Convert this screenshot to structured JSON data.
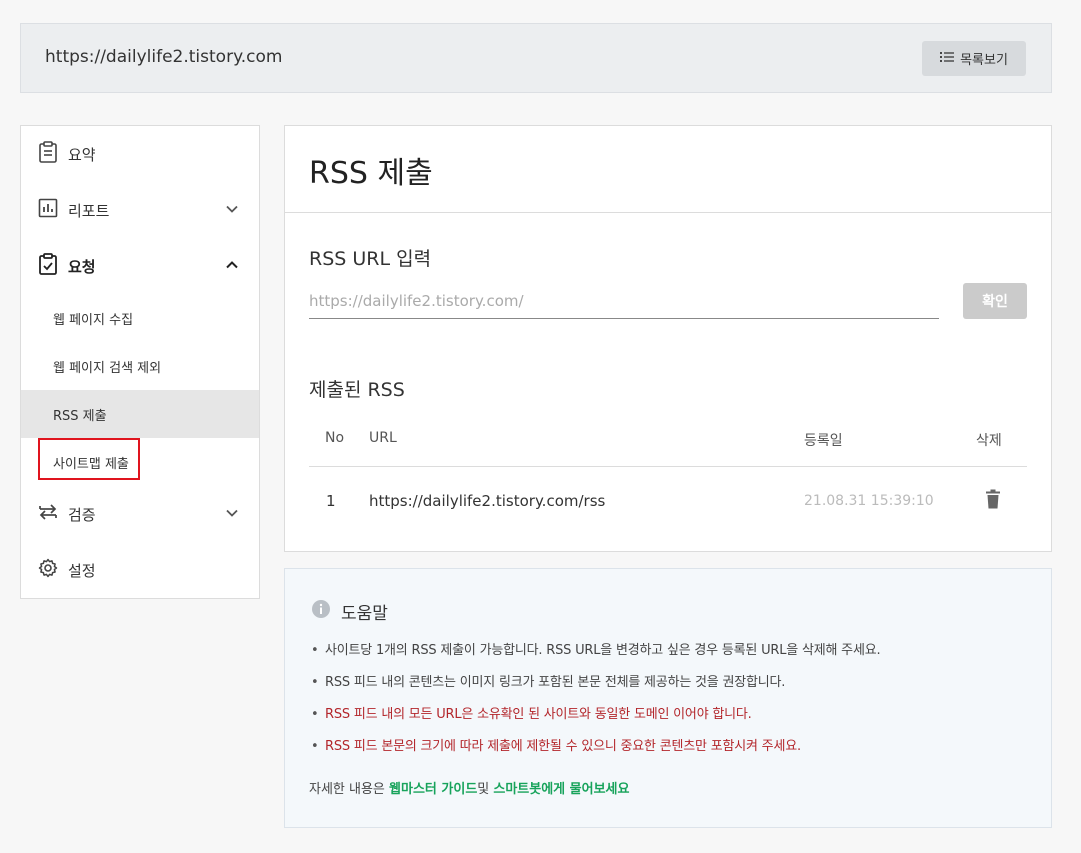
{
  "header": {
    "site_url": "https://dailylife2.tistory.com",
    "list_button_label": "목록보기",
    "list_icon": "list-icon"
  },
  "sidebar": {
    "items": [
      {
        "label": "요약",
        "icon": "clipboard-icon"
      },
      {
        "label": "리포트",
        "icon": "bar-chart-icon"
      },
      {
        "label": "요청",
        "icon": "clipboard-check-icon"
      },
      {
        "label": "검증",
        "icon": "swap-arrows-icon"
      },
      {
        "label": "설정",
        "icon": "gear-icon"
      }
    ],
    "sub_items": [
      {
        "label": "웹 페이지 수집"
      },
      {
        "label": "웹 페이지 검색 제외"
      },
      {
        "label": "RSS 제출"
      },
      {
        "label": "사이트맵 제출"
      }
    ]
  },
  "main": {
    "title": "RSS 제출",
    "input_section_label": "RSS URL 입력",
    "input_placeholder": "https://dailylife2.tistory.com/",
    "confirm_label": "확인",
    "submitted_label": "제출된 RSS",
    "table": {
      "headers": [
        "No",
        "URL",
        "등록일",
        "삭제"
      ],
      "rows": [
        {
          "no": "1",
          "url": "https://dailylife2.tistory.com/rss",
          "date": "21.08.31 15:39:10"
        }
      ]
    }
  },
  "help": {
    "title": "도움말",
    "items": [
      "사이트당 1개의 RSS 제출이 가능합니다. RSS URL을 변경하고 싶은 경우 등록된 URL을 삭제해 주세요.",
      "RSS 피드 내의 콘텐츠는 이미지 링크가 포함된 본문 전체를 제공하는 것을 권장합니다.",
      "RSS 피드 내의 모든 URL은 소유확인 된 사이트와 동일한 도메인 이어야 합니다.",
      "RSS 피드 본문의 크기에 따라 제출에 제한될 수 있으니 중요한 콘텐츠만 포함시켜 주세요."
    ],
    "footer_prefix": "자세한 내용은 ",
    "footer_link1": "웹마스터 가이드",
    "footer_mid": "및 ",
    "footer_link2": "스마트봇에게 물어보세요"
  },
  "colors": {
    "warning_text": "#b3262b",
    "link_green": "#17a35b",
    "highlight_red": "#e0141e"
  }
}
